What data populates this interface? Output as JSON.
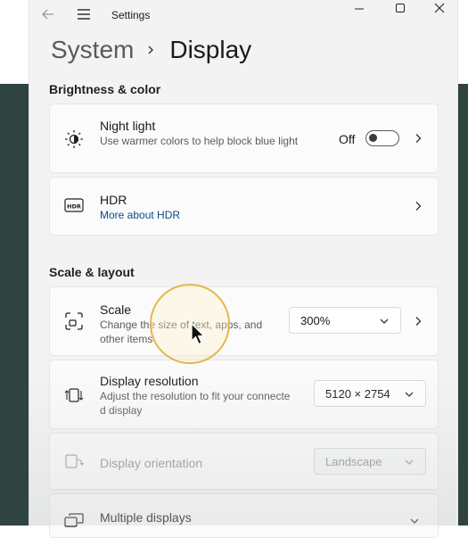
{
  "window": {
    "title": "Settings",
    "breadcrumb_parent": "System",
    "breadcrumb_current": "Display"
  },
  "sections": {
    "brightness": "Brightness & color",
    "scale_layout": "Scale & layout"
  },
  "night_light": {
    "title": "Night light",
    "desc": "Use warmer colors to help block blue light",
    "toggle_state": "Off"
  },
  "hdr": {
    "title": "HDR",
    "link": "More about HDR"
  },
  "scale": {
    "title": "Scale",
    "desc": "Change the size of text, apps, and other items",
    "value": "300%"
  },
  "resolution": {
    "title": "Display resolution",
    "desc": "Adjust the resolution to fit your connecte d display",
    "value": "5120 × 2754"
  },
  "orientation": {
    "title": "Display orientation",
    "value": "Landscape"
  },
  "multiple": {
    "title": "Multiple displays"
  },
  "colors": {
    "accent_link": "#0b4c8c",
    "cursor_highlight": "#e2b84e"
  }
}
